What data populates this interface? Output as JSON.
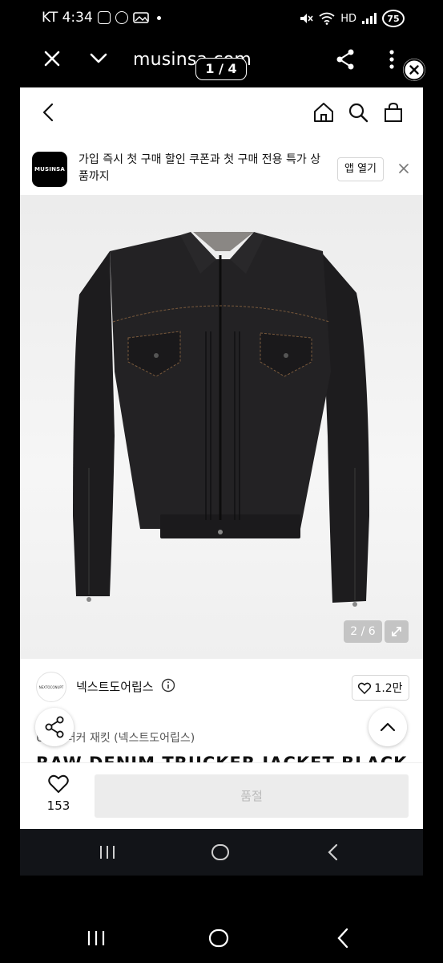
{
  "status_bar": {
    "carrier_time": "KT 4:34",
    "battery": "75",
    "network": "HD"
  },
  "viewer": {
    "site_title": "musinsa.com",
    "image_counter": "1 / 4"
  },
  "banner": {
    "logo_text": "MUSINSA",
    "promo_text": "가입 즉시 첫 구매 할인 쿠폰과 첫 구매 전용 특가 상품까지",
    "open_app_label": "앱 열기"
  },
  "product": {
    "image_counter": "2 / 6",
    "brand_logo_text": "NEXTOCONUPT",
    "brand_name": "넥스트도어립스",
    "like_count": "1.2만",
    "breadcrumb_partial": "U",
    "breadcrumb_category": "트러커 재킷 (넥스트도어립스)",
    "title": "RAW DENIM TRUCKER JACKET BLACK"
  },
  "bottom_bar": {
    "wish_count": "153",
    "buy_label": "품절"
  },
  "colors": {
    "background": "#000000",
    "screen": "#ffffff",
    "soldout_bg": "#ececec",
    "soldout_text": "#b8b8b8",
    "nav_bar": "#121418"
  }
}
